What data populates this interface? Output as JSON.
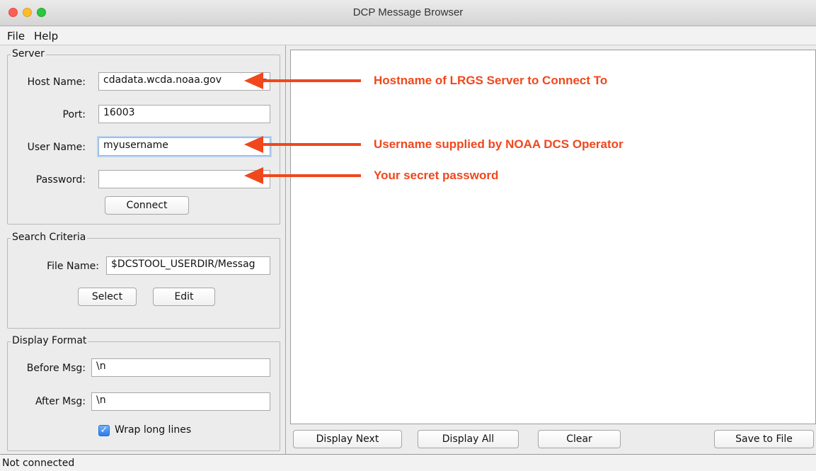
{
  "window": {
    "title": "DCP Message Browser"
  },
  "menu": {
    "items": [
      "File",
      "Help"
    ]
  },
  "server": {
    "legend": "Server",
    "host_label": "Host Name:",
    "host_value": "cdadata.wcda.noaa.gov",
    "port_label": "Port:",
    "port_value": "16003",
    "user_label": "User Name:",
    "user_value": "myusername",
    "password_label": "Password:",
    "password_value": "",
    "connect_label": "Connect"
  },
  "search": {
    "legend": "Search Criteria",
    "file_label": "File Name:",
    "file_value": "$DCSTOOL_USERDIR/Messag",
    "select_label": "Select",
    "edit_label": "Edit"
  },
  "display": {
    "legend": "Display Format",
    "before_label": "Before Msg:",
    "before_value": "\\n",
    "after_label": "After Msg:",
    "after_value": "\\n",
    "wrap_label": "Wrap long lines",
    "wrap_checked": true
  },
  "buttons": {
    "display_next": "Display Next",
    "display_all": "Display All",
    "clear": "Clear",
    "save": "Save to File"
  },
  "status": {
    "text": "Not connected"
  },
  "annotations": {
    "color": "#f0471d",
    "items": [
      "Hostname of LRGS Server to Connect To",
      "Username supplied by NOAA DCS Operator",
      "Your secret password"
    ]
  }
}
